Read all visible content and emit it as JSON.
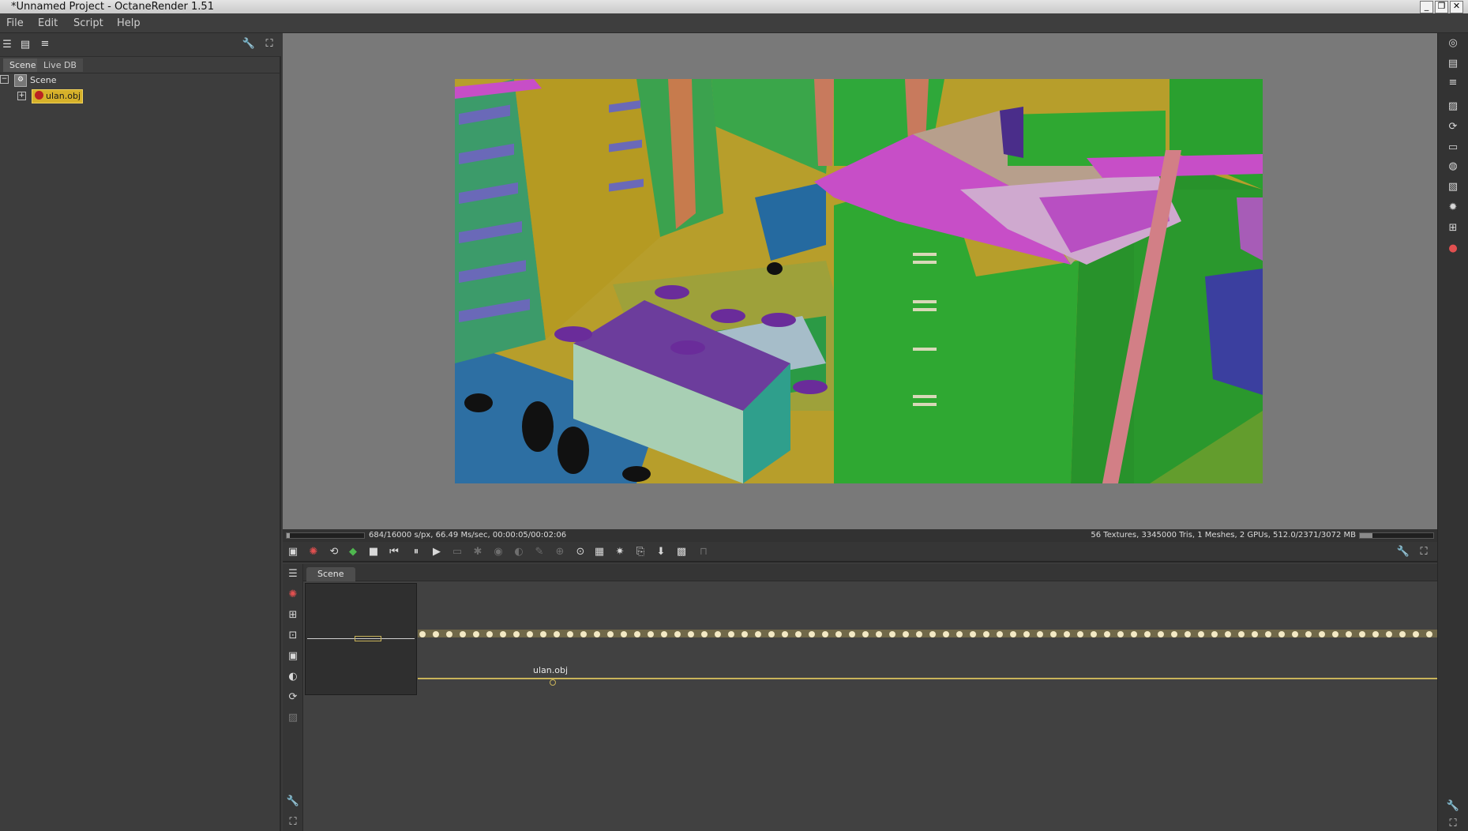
{
  "window": {
    "title": "*Unnamed Project - OctaneRender 1.51",
    "buttons": {
      "minimize": "_",
      "restore": "❐",
      "close": "✕"
    }
  },
  "menu": [
    "File",
    "Edit",
    "Script",
    "Help"
  ],
  "left_panel": {
    "tabs": [
      "Scene",
      "Live DB"
    ],
    "tree": {
      "root": "Scene",
      "child": "ulan.obj"
    }
  },
  "status": {
    "left": "684/16000 s/px, 66.49 Ms/sec, 00:00:05/00:02:06",
    "right": "56 Textures, 3345000 Tris, 1 Meshes, 2 GPUs, 512.0/2371/3072 MB"
  },
  "progress": {
    "render_fraction": 0.043,
    "memory_fraction": 0.17
  },
  "graph": {
    "tab": "Scene",
    "node_label": "ulan.obj"
  },
  "colors": {
    "accent_gold": "#c8b35a",
    "selection": "#d6b12a",
    "facade_green": "#2fa832",
    "roof_magenta": "#c74ec7",
    "floor_yellow": "#b99e2c"
  }
}
